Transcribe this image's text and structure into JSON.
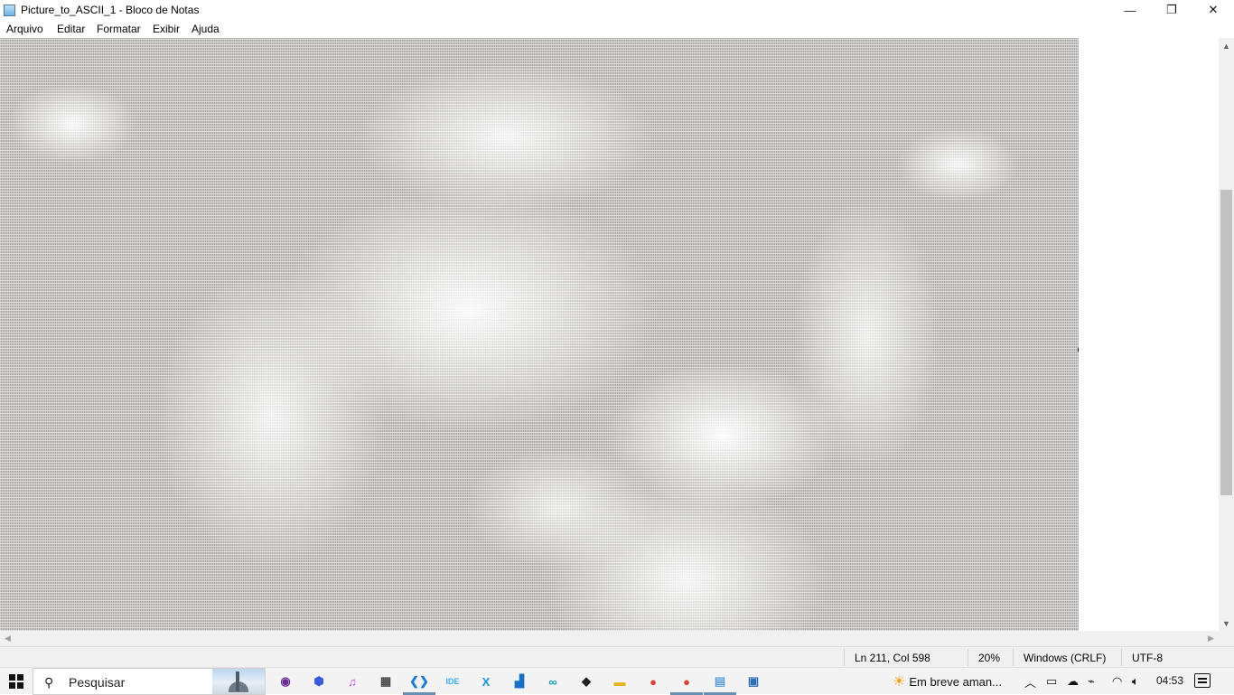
{
  "window": {
    "title": "Picture_to_ASCII_1 - Bloco de Notas",
    "minimize_glyph": "—",
    "maximize_glyph": "❐",
    "close_glyph": "✕"
  },
  "menu": {
    "items": [
      "Arquivo",
      "Editar",
      "Formatar",
      "Exibir",
      "Ajuda"
    ]
  },
  "editor": {
    "content_kind": "ascii-art-portrait"
  },
  "statusbar": {
    "position": "Ln 211, Col 598",
    "zoom": "20%",
    "line_ending": "Windows (CRLF)",
    "encoding": "UTF-8"
  },
  "taskbar": {
    "search_placeholder": "Pesquisar",
    "pinned_icons": [
      {
        "name": "podcast-app-icon",
        "glyph": "◉",
        "color": "#6a2c91"
      },
      {
        "name": "cube-app-icon",
        "glyph": "⬢",
        "color": "#3b5bdb"
      },
      {
        "name": "itunes-icon",
        "glyph": "♫",
        "color": "#c44bd6"
      },
      {
        "name": "calculator-icon",
        "glyph": "▦",
        "color": "#4a4a4a"
      },
      {
        "name": "vscode-icon",
        "glyph": "❮❯",
        "color": "#1f7ad1"
      },
      {
        "name": "ide-icon",
        "glyph": "IDE",
        "color": "#3fa9f5"
      },
      {
        "name": "xampp-icon",
        "glyph": "X",
        "color": "#1c8fd6"
      },
      {
        "name": "sublime-icon",
        "glyph": "▟",
        "color": "#1a6fc4"
      },
      {
        "name": "arduino-icon",
        "glyph": "∞",
        "color": "#0f9aa3"
      },
      {
        "name": "inkscape-icon",
        "glyph": "◆",
        "color": "#222222"
      },
      {
        "name": "file-explorer-icon",
        "glyph": "▬",
        "color": "#e6b422"
      },
      {
        "name": "chrome-icon",
        "glyph": "●",
        "color": "#db4437"
      },
      {
        "name": "chrome-profile-icon",
        "glyph": "●",
        "color": "#db4437"
      },
      {
        "name": "notepad-icon",
        "glyph": "▤",
        "color": "#5fa0d8"
      },
      {
        "name": "terminal-icon",
        "glyph": "▣",
        "color": "#2d6fb0"
      }
    ],
    "weather_text": "Em breve aman...",
    "clock_time": "04:53"
  }
}
